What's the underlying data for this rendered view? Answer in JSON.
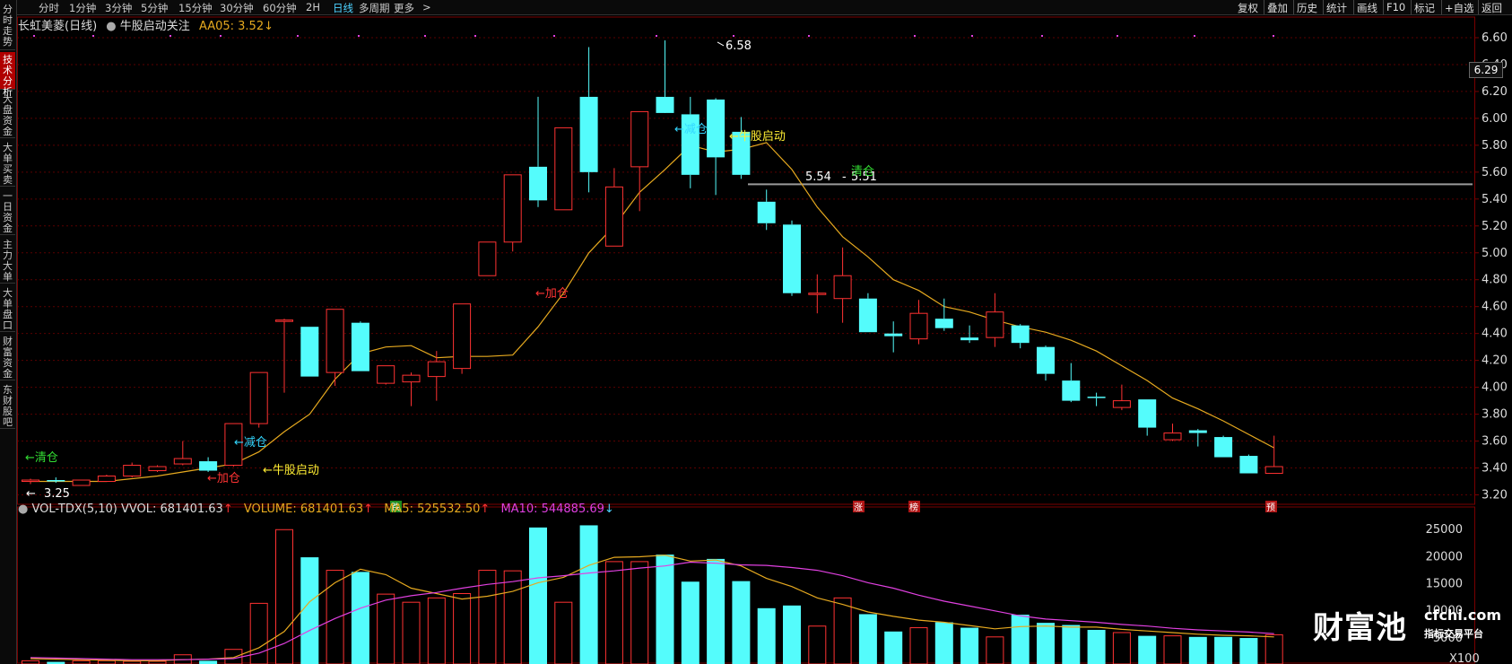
{
  "left_tabs": [
    {
      "label": "分时走势",
      "active": false
    },
    {
      "label": "技术分析",
      "active": true
    },
    {
      "label": "大盘资金",
      "active": false
    },
    {
      "label": "大单买卖",
      "active": false
    },
    {
      "label": "一日资金",
      "active": false
    },
    {
      "label": "主力大单",
      "active": false
    },
    {
      "label": "大单盘口",
      "active": false
    },
    {
      "label": "财富资金",
      "active": false
    },
    {
      "label": "东财股吧",
      "active": false
    }
  ],
  "timeframes": [
    "分时",
    "1分钟",
    "3分钟",
    "5分钟",
    "15分钟",
    "30分钟",
    "60分钟",
    "2H",
    "日线",
    "多周期",
    "更多"
  ],
  "active_timeframe": "日线",
  "more_glyph": ">",
  "right_tools": [
    "复权",
    "叠加",
    "历史",
    "统计",
    "画线",
    "F10",
    "标记",
    "+自选",
    "返回"
  ],
  "chart_title": {
    "stock": "长虹美菱(日线)",
    "indicator": "牛股启动关注",
    "aa_label": "AA05: 3.52",
    "aa_arrow": "↓"
  },
  "price_axis_labels": [
    "6.60",
    "6.40",
    "6.20",
    "6.00",
    "5.80",
    "5.60",
    "5.40",
    "5.20",
    "5.00",
    "4.80",
    "4.60",
    "4.40",
    "4.20",
    "4.00",
    "3.80",
    "3.60",
    "3.40",
    "3.20"
  ],
  "current_price_label": "6.29",
  "annotations": {
    "high_label": "6.58",
    "low_label": "3.25",
    "hline_left": "5.54",
    "hline_right": "5.51",
    "signals": [
      {
        "text": "←清仓",
        "color": "#33dd33"
      },
      {
        "text": "←加仓",
        "color": "#ff3333"
      },
      {
        "text": "←减仓",
        "color": "#33d6ff"
      },
      {
        "text": "←牛股启动",
        "color": "#ffee33"
      },
      {
        "text": "←加仓",
        "color": "#ff3333"
      },
      {
        "text": "←减仓",
        "color": "#33d6ff"
      },
      {
        "text": "←牛股启动",
        "color": "#ffee33"
      },
      {
        "text": "清仓",
        "color": "#33dd33"
      }
    ],
    "markers": [
      {
        "text": "跌",
        "bg": "#1e8a1e"
      },
      {
        "text": "涨",
        "bg": "#b01515"
      },
      {
        "text": "榜",
        "bg": "#b01515"
      },
      {
        "text": "预",
        "bg": "#b01515"
      }
    ]
  },
  "volume_panel": {
    "title": "VOL-TDX(5,10)",
    "vvol": "VVOL: 681401.63",
    "volume": "VOLUME: 681401.63",
    "ma5": "MA5: 525532.50",
    "ma10": "MA10: 544885.69",
    "up_arrow": "↑",
    "down_arrow": "↓",
    "axis_labels": [
      "25000",
      "20000",
      "15000",
      "10000",
      "5000"
    ],
    "unit_label": "X100"
  },
  "watermark": {
    "cn": "财富池",
    "site": "cfchi.com",
    "slogan": "指标交易平台"
  },
  "colors": {
    "up": "#ff3232",
    "down": "#54fcfc",
    "ma5": "#e6a91f",
    "ma10": "#e040e0",
    "grid": "#5a0000",
    "hline": "#9a9a9a"
  },
  "chart_data": {
    "type": "candlestick",
    "candles": [
      {
        "o": 3.3,
        "h": 3.32,
        "l": 3.28,
        "c": 3.31
      },
      {
        "o": 3.31,
        "h": 3.33,
        "l": 3.29,
        "c": 3.3
      },
      {
        "o": 3.27,
        "h": 3.31,
        "l": 3.27,
        "c": 3.31
      },
      {
        "o": 3.3,
        "h": 3.35,
        "l": 3.3,
        "c": 3.34
      },
      {
        "o": 3.34,
        "h": 3.44,
        "l": 3.33,
        "c": 3.42
      },
      {
        "o": 3.38,
        "h": 3.42,
        "l": 3.37,
        "c": 3.41
      },
      {
        "o": 3.43,
        "h": 3.6,
        "l": 3.42,
        "c": 3.47
      },
      {
        "o": 3.45,
        "h": 3.48,
        "l": 3.37,
        "c": 3.38
      },
      {
        "o": 3.42,
        "h": 3.73,
        "l": 3.41,
        "c": 3.73
      },
      {
        "o": 3.73,
        "h": 4.11,
        "l": 3.7,
        "c": 4.11
      },
      {
        "o": 4.5,
        "h": 4.51,
        "l": 3.96,
        "c": 4.5
      },
      {
        "o": 4.45,
        "h": 4.45,
        "l": 4.08,
        "c": 4.08
      },
      {
        "o": 4.11,
        "h": 4.58,
        "l": 4.01,
        "c": 4.58
      },
      {
        "o": 4.48,
        "h": 4.49,
        "l": 4.12,
        "c": 4.12
      },
      {
        "o": 4.03,
        "h": 4.16,
        "l": 4.02,
        "c": 4.16
      },
      {
        "o": 4.04,
        "h": 4.11,
        "l": 3.86,
        "c": 4.09
      },
      {
        "o": 4.08,
        "h": 4.27,
        "l": 3.9,
        "c": 4.19
      },
      {
        "o": 4.14,
        "h": 4.62,
        "l": 4.1,
        "c": 4.62
      },
      {
        "o": 4.83,
        "h": 5.08,
        "l": 4.83,
        "c": 5.08
      },
      {
        "o": 5.08,
        "h": 5.58,
        "l": 5.01,
        "c": 5.58
      },
      {
        "o": 5.64,
        "h": 6.16,
        "l": 5.34,
        "c": 5.39
      },
      {
        "o": 5.32,
        "h": 5.93,
        "l": 5.32,
        "c": 5.93
      },
      {
        "o": 6.16,
        "h": 6.53,
        "l": 5.45,
        "c": 5.6
      },
      {
        "o": 5.05,
        "h": 5.63,
        "l": 5.05,
        "c": 5.49
      },
      {
        "o": 5.64,
        "h": 6.05,
        "l": 5.31,
        "c": 6.05
      },
      {
        "o": 6.16,
        "h": 6.58,
        "l": 6.09,
        "c": 6.04
      },
      {
        "o": 6.03,
        "h": 6.16,
        "l": 5.48,
        "c": 5.58
      },
      {
        "o": 6.14,
        "h": 6.15,
        "l": 5.43,
        "c": 5.71
      },
      {
        "o": 5.9,
        "h": 6.01,
        "l": 5.55,
        "c": 5.58
      },
      {
        "o": 5.38,
        "h": 5.47,
        "l": 5.17,
        "c": 5.22
      },
      {
        "o": 5.21,
        "h": 5.24,
        "l": 4.68,
        "c": 4.7
      },
      {
        "o": 4.69,
        "h": 4.84,
        "l": 4.55,
        "c": 4.7
      },
      {
        "o": 4.66,
        "h": 5.04,
        "l": 4.48,
        "c": 4.83
      },
      {
        "o": 4.66,
        "h": 4.7,
        "l": 4.41,
        "c": 4.41
      },
      {
        "o": 4.4,
        "h": 4.49,
        "l": 4.26,
        "c": 4.38
      },
      {
        "o": 4.36,
        "h": 4.65,
        "l": 4.32,
        "c": 4.55
      },
      {
        "o": 4.51,
        "h": 4.66,
        "l": 4.42,
        "c": 4.44
      },
      {
        "o": 4.37,
        "h": 4.46,
        "l": 4.33,
        "c": 4.35
      },
      {
        "o": 4.37,
        "h": 4.7,
        "l": 4.3,
        "c": 4.56
      },
      {
        "o": 4.46,
        "h": 4.47,
        "l": 4.29,
        "c": 4.33
      },
      {
        "o": 4.3,
        "h": 4.31,
        "l": 4.05,
        "c": 4.1
      },
      {
        "o": 4.05,
        "h": 4.18,
        "l": 3.89,
        "c": 3.9
      },
      {
        "o": 3.93,
        "h": 3.96,
        "l": 3.86,
        "c": 3.92
      },
      {
        "o": 3.85,
        "h": 4.02,
        "l": 3.83,
        "c": 3.9
      },
      {
        "o": 3.91,
        "h": 3.91,
        "l": 3.64,
        "c": 3.7
      },
      {
        "o": 3.61,
        "h": 3.73,
        "l": 3.6,
        "c": 3.66
      },
      {
        "o": 3.68,
        "h": 3.69,
        "l": 3.56,
        "c": 3.66
      },
      {
        "o": 3.63,
        "h": 3.64,
        "l": 3.48,
        "c": 3.48
      },
      {
        "o": 3.49,
        "h": 3.5,
        "l": 3.36,
        "c": 3.36
      },
      {
        "o": 3.36,
        "h": 3.64,
        "l": 3.36,
        "c": 3.41
      }
    ],
    "ma5": [
      3.3,
      3.3,
      3.3,
      3.3,
      3.32,
      3.34,
      3.37,
      3.4,
      3.43,
      3.52,
      3.67,
      3.8,
      4.06,
      4.25,
      4.3,
      4.31,
      4.22,
      4.23,
      4.23,
      4.24,
      4.45,
      4.7,
      5.0,
      5.2,
      5.45,
      5.62,
      5.8,
      5.75,
      5.77,
      5.82,
      5.62,
      5.34,
      5.12,
      4.97,
      4.8,
      4.72,
      4.6,
      4.56,
      4.5,
      4.45,
      4.41,
      4.35,
      4.27,
      4.16,
      4.05,
      3.92,
      3.84,
      3.75,
      3.65,
      3.55
    ],
    "ma10": [
      3.3,
      3.3,
      3.3,
      3.3,
      3.31,
      3.32,
      3.34,
      3.36,
      3.38,
      3.42,
      3.5,
      3.58,
      3.7,
      3.82,
      3.9,
      3.98,
      4.05,
      4.12,
      4.18,
      4.23,
      4.32,
      4.44,
      4.58,
      4.72,
      4.85,
      5.0,
      5.15,
      5.28,
      5.4,
      5.5,
      5.55,
      5.52,
      5.47,
      5.4,
      5.3,
      5.18,
      5.05,
      4.94,
      4.84,
      4.76,
      4.68,
      4.6,
      4.52,
      4.44,
      4.36,
      4.28,
      4.2,
      4.12,
      4.04,
      3.96
    ],
    "volume": [
      600,
      400,
      600,
      600,
      500,
      500,
      1700,
      600,
      2700,
      11200,
      24800,
      19700,
      17300,
      17000,
      12900,
      11400,
      12200,
      13000,
      17300,
      17200,
      25200,
      11400,
      25600,
      18900,
      18900,
      20200,
      15200,
      19400,
      15300,
      10300,
      10800,
      7000,
      12200,
      9200,
      6000,
      6700,
      7700,
      6700,
      5000,
      9100,
      7600,
      7200,
      6300,
      5800,
      5200,
      5200,
      5000,
      5000,
      4800,
      5400
    ],
    "vol_ma5": [
      1000,
      900,
      800,
      700,
      600,
      600,
      800,
      900,
      1200,
      3000,
      6000,
      11500,
      15000,
      17500,
      16500,
      14000,
      13000,
      12000,
      12500,
      13400,
      15000,
      16000,
      18200,
      19700,
      19800,
      20100,
      19000,
      19200,
      18100,
      15800,
      14300,
      12200,
      11000,
      9600,
      8800,
      8100,
      7700,
      7100,
      6500,
      6900,
      7000,
      6800,
      6800,
      6400,
      6100,
      5800,
      5500,
      5300,
      5200,
      5000
    ],
    "vol_ma10": [
      1200,
      1100,
      1000,
      900,
      800,
      800,
      800,
      900,
      1000,
      2000,
      3800,
      6200,
      8400,
      10300,
      11800,
      12600,
      13200,
      14000,
      14700,
      15200,
      15900,
      16300,
      16800,
      17200,
      17700,
      18100,
      18800,
      18600,
      18300,
      18200,
      17800,
      17300,
      16300,
      15000,
      14000,
      12700,
      11600,
      10700,
      9800,
      8900,
      8300,
      8000,
      7700,
      7300,
      7000,
      6600,
      6300,
      6100,
      5900,
      5600
    ],
    "price_range": [
      3.17,
      6.66
    ],
    "volume_range": [
      0,
      27000
    ],
    "volume_unit": "X100",
    "hline": [
      5.51,
      5.51
    ]
  }
}
